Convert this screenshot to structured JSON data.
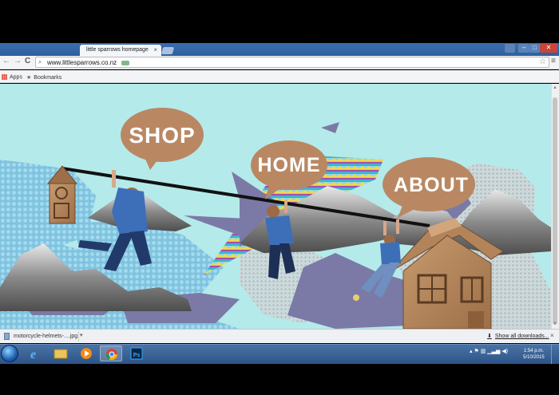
{
  "browser": {
    "tab_title": "little sparrows homepage",
    "tab_close": "×",
    "url": "www.littlesparrows.co.nz",
    "back": "←",
    "forward": "→",
    "reload": "C",
    "star": "☆",
    "menu": "≡"
  },
  "bookmarks_bar": {
    "apps": "Apps",
    "bookmarks": "Bookmarks"
  },
  "page": {
    "nav": {
      "shop": "SHOP",
      "home": "HOME",
      "about": "ABOUT"
    }
  },
  "downloads": {
    "file_name": "motorcycle-helmets-....jpg",
    "show_all": "Show all downloads...",
    "close": "×"
  },
  "taskbar": {
    "time": "1:54 p.m.",
    "date": "5/10/2015",
    "ps_label": "Ps"
  },
  "colors": {
    "sky": "#b5eaea",
    "bubble": "#b98863",
    "bubble_text": "#ffffff",
    "pattern": "#7fc3df",
    "mountain": "#8c8c8c",
    "purple_shadow": "#7b7aa6",
    "cardboard": "#b3835a"
  }
}
